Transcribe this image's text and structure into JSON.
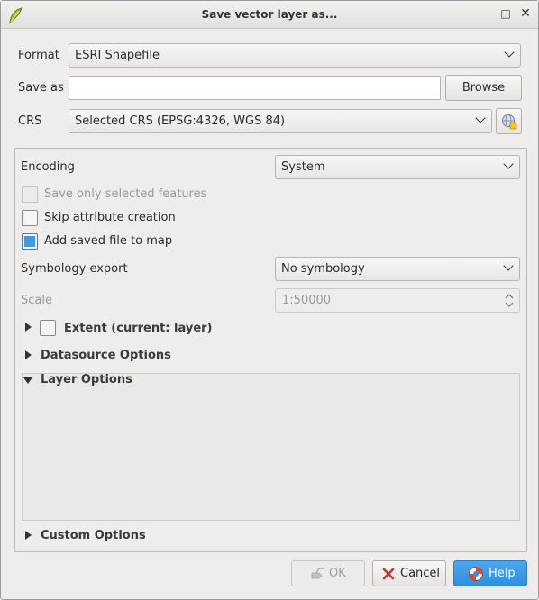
{
  "window": {
    "title": "Save vector layer as..."
  },
  "form": {
    "format_label": "Format",
    "format_value": "ESRI Shapefile",
    "save_as_label": "Save as",
    "save_as_value": "",
    "browse_label": "Browse",
    "crs_label": "CRS",
    "crs_value": "Selected CRS (EPSG:4326, WGS 84)"
  },
  "options": {
    "encoding_label": "Encoding",
    "encoding_value": "System",
    "save_selected_label": "Save only selected features",
    "save_selected_checked": false,
    "skip_attr_label": "Skip attribute creation",
    "skip_attr_checked": false,
    "add_to_map_label": "Add saved file to map",
    "add_to_map_checked": true,
    "symbology_label": "Symbology export",
    "symbology_value": "No symbology",
    "scale_label": "Scale",
    "scale_value": "1:50000",
    "extent_label": "Extent (current: layer)",
    "datasource_label": "Datasource Options",
    "layer_options_label": "Layer Options",
    "custom_options_label": "Custom Options"
  },
  "buttons": {
    "ok_label": "OK",
    "cancel_label": "Cancel",
    "help_label": "Help"
  },
  "colors": {
    "accent": "#3d9ae2",
    "cancel_icon": "#c0392b"
  }
}
